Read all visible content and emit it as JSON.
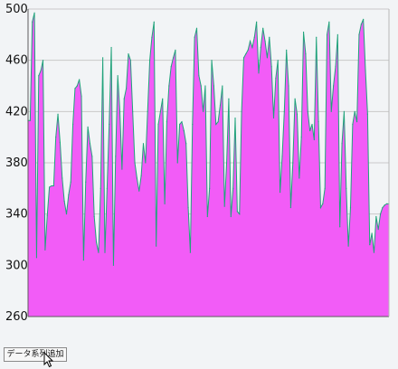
{
  "chart_data": {
    "type": "area",
    "title": "",
    "xlabel": "",
    "ylabel": "",
    "ylim": [
      260,
      500
    ],
    "yticks": [
      260,
      300,
      340,
      380,
      420,
      460,
      500
    ],
    "grid": true,
    "legend": "none",
    "series": [
      {
        "fill_color": "#f25cf7",
        "line_color": "#21a37b",
        "values": [
          413,
          413,
          490,
          497,
          306,
          448,
          452,
          460,
          312,
          339,
          361,
          362,
          362,
          400,
          418,
          396,
          368,
          350,
          340,
          355,
          365,
          410,
          438,
          440,
          445,
          432,
          304,
          365,
          408,
          395,
          385,
          338,
          318,
          310,
          360,
          462,
          310,
          360,
          410,
          470,
          300,
          385,
          448,
          420,
          375,
          430,
          438,
          465,
          460,
          420,
          380,
          368,
          358,
          370,
          395,
          380,
          420,
          460,
          478,
          490,
          315,
          410,
          420,
          430,
          348,
          412,
          440,
          455,
          462,
          468,
          380,
          410,
          412,
          405,
          395,
          345,
          310,
          410,
          478,
          485,
          448,
          440,
          420,
          440,
          338,
          360,
          460,
          440,
          410,
          412,
          425,
          440,
          346,
          380,
          430,
          338,
          360,
          415,
          342,
          340,
          420,
          462,
          465,
          468,
          475,
          470,
          478,
          490,
          450,
          470,
          485,
          475,
          462,
          478,
          455,
          415,
          446,
          460,
          357,
          385,
          420,
          468,
          440,
          345,
          380,
          430,
          418,
          368,
          400,
          482,
          465,
          420,
          405,
          410,
          398,
          478,
          412,
          345,
          348,
          360,
          480,
          490,
          420,
          440,
          455,
          480,
          330,
          395,
          420,
          360,
          315,
          345,
          410,
          420,
          412,
          480,
          488,
          492,
          452,
          418,
          316,
          325,
          310,
          338,
          328,
          340,
          345,
          347,
          348,
          348
        ]
      }
    ]
  },
  "controls": {
    "add_series_label": "データ系列追加"
  },
  "icons": {
    "cursor": "arrow-cursor-icon"
  }
}
